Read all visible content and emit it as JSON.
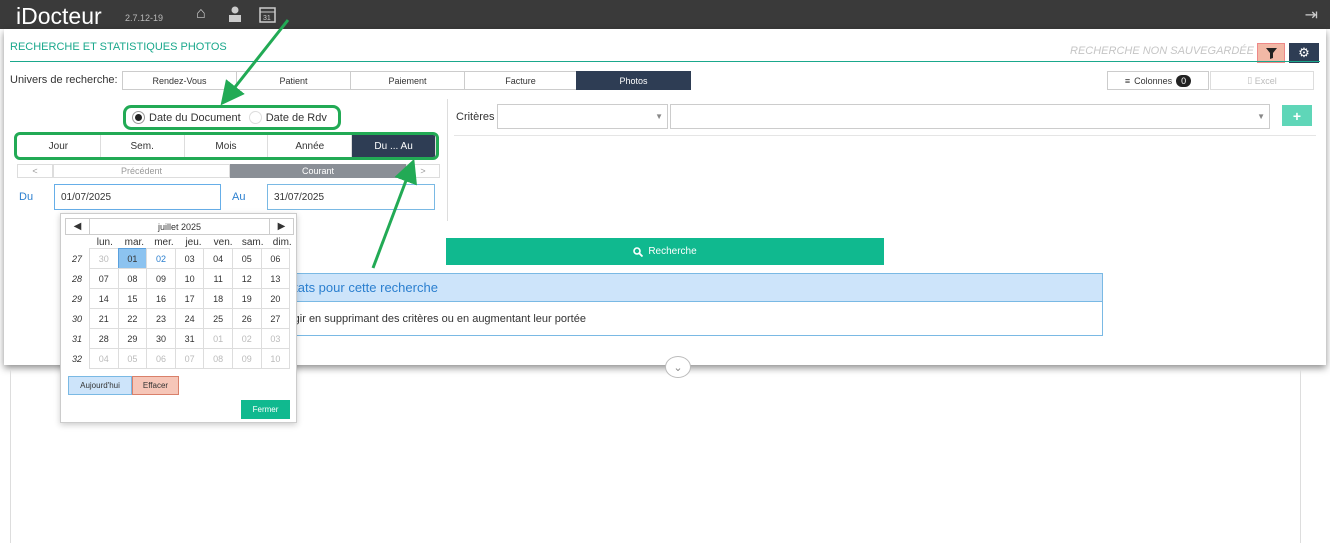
{
  "app": {
    "name": "iDocteur",
    "version": "2.7.12-19"
  },
  "topbar_icons": [
    "home-icon",
    "users-icon",
    "calendar-icon"
  ],
  "calendar_icon_text": "31",
  "page": {
    "title": "RECHERCHE ET STATISTIQUES PHOTOS",
    "save_status": "RECHERCHE NON SAUVEGARDÉE"
  },
  "univers": {
    "label": "Univers de recherche:",
    "tabs": [
      "Rendez-Vous",
      "Patient",
      "Paiement",
      "Facture",
      "Photos"
    ],
    "active": "Photos"
  },
  "columns": {
    "label": "Colonnes",
    "count": "0"
  },
  "excel": {
    "label": "Excel"
  },
  "date_type": {
    "document": "Date du Document",
    "rdv": "Date de Rdv",
    "selected": "document"
  },
  "period": {
    "tabs": [
      "Jour",
      "Sem.",
      "Mois",
      "Année",
      "Du ... Au"
    ],
    "active": "Du ... Au"
  },
  "nav": {
    "prev_arrow": "<",
    "prev": "Précédent",
    "current": "Courant",
    "next_arrow": ">"
  },
  "range": {
    "from_label": "Du",
    "from_value": "01/07/2025",
    "to_label": "Au",
    "to_value": "31/07/2025"
  },
  "criteria": {
    "label": "Critères"
  },
  "search": {
    "label": "Recherche"
  },
  "results": {
    "header": "ultats pour cette recherche",
    "body": "rgir en supprimant des critères ou en augmentant leur portée"
  },
  "datepicker": {
    "month": "juillet 2025",
    "weekdays": [
      "lun.",
      "mar.",
      "mer.",
      "jeu.",
      "ven.",
      "sam.",
      "dim."
    ],
    "weeks": [
      {
        "num": "27",
        "days": [
          "30",
          "01",
          "02",
          "03",
          "04",
          "05",
          "06"
        ]
      },
      {
        "num": "28",
        "days": [
          "07",
          "08",
          "09",
          "10",
          "11",
          "12",
          "13"
        ]
      },
      {
        "num": "29",
        "days": [
          "14",
          "15",
          "16",
          "17",
          "18",
          "19",
          "20"
        ]
      },
      {
        "num": "30",
        "days": [
          "21",
          "22",
          "23",
          "24",
          "25",
          "26",
          "27"
        ]
      },
      {
        "num": "31",
        "days": [
          "28",
          "29",
          "30",
          "31",
          "01",
          "02",
          "03"
        ]
      },
      {
        "num": "32",
        "days": [
          "04",
          "05",
          "06",
          "07",
          "08",
          "09",
          "10"
        ]
      }
    ],
    "today_btn": "Aujourd'hui",
    "clear_btn": "Effacer",
    "close_btn": "Fermer"
  },
  "colors": {
    "accent": "#10b98f",
    "navy": "#2e3d54",
    "highlight": "#22aa55",
    "link": "#2b7fcf"
  }
}
